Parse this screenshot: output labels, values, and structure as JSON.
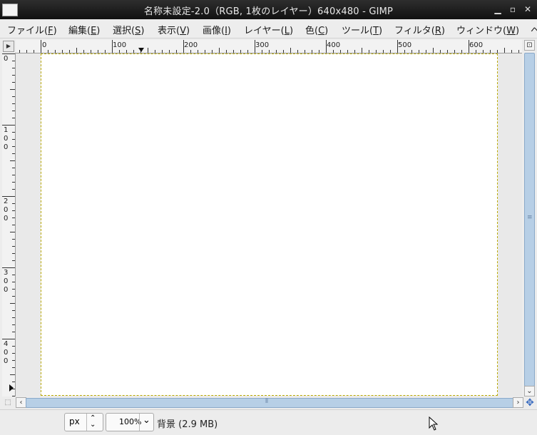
{
  "window": {
    "title": "名称未設定-2.0（RGB, 1枚のレイヤー）640x480 - GIMP",
    "controls": {
      "minimize": "▁",
      "maximize": "▫",
      "close": "✕"
    }
  },
  "menubar": {
    "items": [
      {
        "label": "ファイル(",
        "mnemonic": "F",
        "tail": ")"
      },
      {
        "label": "編集(",
        "mnemonic": "E",
        "tail": ")"
      },
      {
        "label": "選択(",
        "mnemonic": "S",
        "tail": ")"
      },
      {
        "label": "表示(",
        "mnemonic": "V",
        "tail": ")"
      },
      {
        "label": "画像(",
        "mnemonic": "I",
        "tail": ")"
      },
      {
        "label": "レイヤー(",
        "mnemonic": "L",
        "tail": ")"
      },
      {
        "label": "色(",
        "mnemonic": "C",
        "tail": ")"
      },
      {
        "label": "ツール(",
        "mnemonic": "T",
        "tail": ")"
      },
      {
        "label": "フィルタ(",
        "mnemonic": "R",
        "tail": ")"
      },
      {
        "label": "ウィンドウ(",
        "mnemonic": "W",
        "tail": ")"
      },
      {
        "label": "ヘ",
        "mnemonic": "",
        "tail": ""
      }
    ]
  },
  "rulers": {
    "horizontal_labels": [
      "0",
      "100",
      "200",
      "300",
      "400",
      "500",
      "600"
    ],
    "vertical_labels": [
      "0",
      "100",
      "200",
      "300",
      "400"
    ]
  },
  "canvas": {
    "image_width": 640,
    "image_height": 480,
    "background_color": "#ffffff",
    "boundary_color": "#b8a800"
  },
  "statusbar": {
    "unit": "px",
    "zoom": "100%",
    "layer_info": "背景 (2.9 MB)"
  },
  "icons": {
    "quick_mask": "quick-mask-icon",
    "navigate": "navigate-icon",
    "ruler_menu": "ruler-menu-icon",
    "zoom_image": "zoom-image-icon"
  }
}
